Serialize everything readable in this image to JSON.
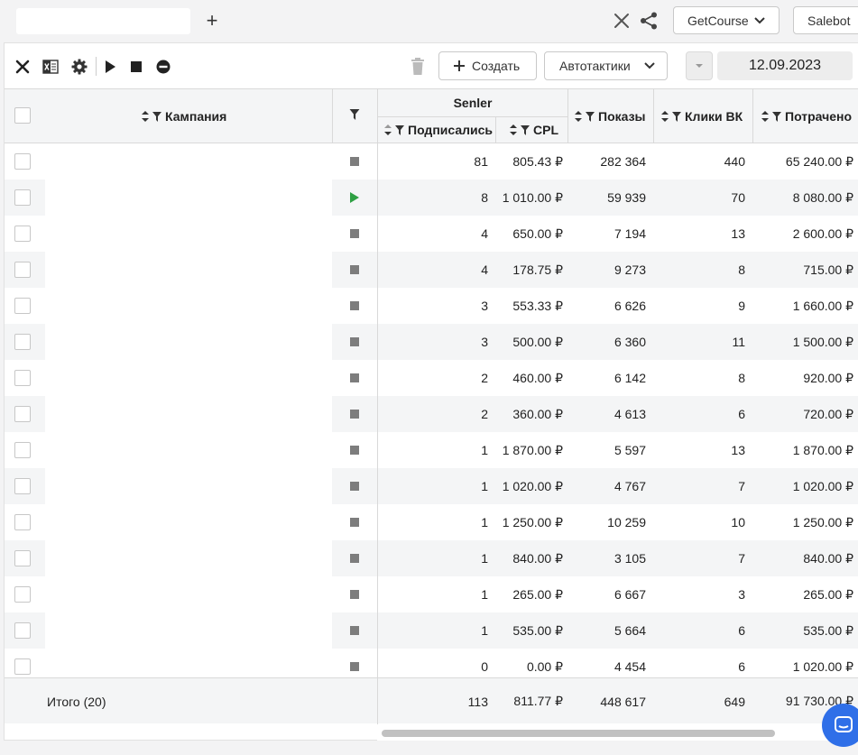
{
  "topbar": {
    "add_tab_symbol": "+",
    "getcourse_label": "GetCourse",
    "salebot_label": "Salebot"
  },
  "toolbar": {
    "create_label": "Создать",
    "autotactics_label": "Автотактики",
    "date": "12.09.2023"
  },
  "table": {
    "headers": {
      "campaign": "Кампания",
      "group_senler": "Senler",
      "subscribed": "Подписались",
      "cpl": "CPL",
      "impressions": "Показы",
      "clicks_vk": "Клики ВК",
      "spent": "Потрачено"
    },
    "rows": [
      {
        "status": "stopped",
        "subscribed": "81",
        "cpl": "805.43 ₽",
        "impressions": "282 364",
        "clicks": "440",
        "spent": "65 240.00 ₽"
      },
      {
        "status": "running",
        "subscribed": "8",
        "cpl": "1 010.00 ₽",
        "impressions": "59 939",
        "clicks": "70",
        "spent": "8 080.00 ₽"
      },
      {
        "status": "stopped",
        "subscribed": "4",
        "cpl": "650.00 ₽",
        "impressions": "7 194",
        "clicks": "13",
        "spent": "2 600.00 ₽"
      },
      {
        "status": "stopped",
        "subscribed": "4",
        "cpl": "178.75 ₽",
        "impressions": "9 273",
        "clicks": "8",
        "spent": "715.00 ₽"
      },
      {
        "status": "stopped",
        "subscribed": "3",
        "cpl": "553.33 ₽",
        "impressions": "6 626",
        "clicks": "9",
        "spent": "1 660.00 ₽"
      },
      {
        "status": "stopped",
        "subscribed": "3",
        "cpl": "500.00 ₽",
        "impressions": "6 360",
        "clicks": "11",
        "spent": "1 500.00 ₽"
      },
      {
        "status": "stopped",
        "subscribed": "2",
        "cpl": "460.00 ₽",
        "impressions": "6 142",
        "clicks": "8",
        "spent": "920.00 ₽"
      },
      {
        "status": "stopped",
        "subscribed": "2",
        "cpl": "360.00 ₽",
        "impressions": "4 613",
        "clicks": "6",
        "spent": "720.00 ₽"
      },
      {
        "status": "stopped",
        "subscribed": "1",
        "cpl": "1 870.00 ₽",
        "impressions": "5 597",
        "clicks": "13",
        "spent": "1 870.00 ₽"
      },
      {
        "status": "stopped",
        "subscribed": "1",
        "cpl": "1 020.00 ₽",
        "impressions": "4 767",
        "clicks": "7",
        "spent": "1 020.00 ₽"
      },
      {
        "status": "stopped",
        "subscribed": "1",
        "cpl": "1 250.00 ₽",
        "impressions": "10 259",
        "clicks": "10",
        "spent": "1 250.00 ₽"
      },
      {
        "status": "stopped",
        "subscribed": "1",
        "cpl": "840.00 ₽",
        "impressions": "3 105",
        "clicks": "7",
        "spent": "840.00 ₽"
      },
      {
        "status": "stopped",
        "subscribed": "1",
        "cpl": "265.00 ₽",
        "impressions": "6 667",
        "clicks": "3",
        "spent": "265.00 ₽"
      },
      {
        "status": "stopped",
        "subscribed": "1",
        "cpl": "535.00 ₽",
        "impressions": "5 664",
        "clicks": "6",
        "spent": "535.00 ₽"
      },
      {
        "status": "stopped",
        "subscribed": "0",
        "cpl": "0.00 ₽",
        "impressions": "4 454",
        "clicks": "6",
        "spent": "1 020.00 ₽"
      }
    ],
    "footer": {
      "label": "Итого (20)",
      "subscribed": "113",
      "cpl": "811.77 ₽",
      "impressions": "448 617",
      "clicks": "649",
      "spent": "91 730.00 ₽"
    }
  },
  "colors": {
    "accent": "#2f6fe8",
    "running": "#2ea043",
    "stopped": "#7d7d7d",
    "header_bg": "#f4f5f6"
  }
}
